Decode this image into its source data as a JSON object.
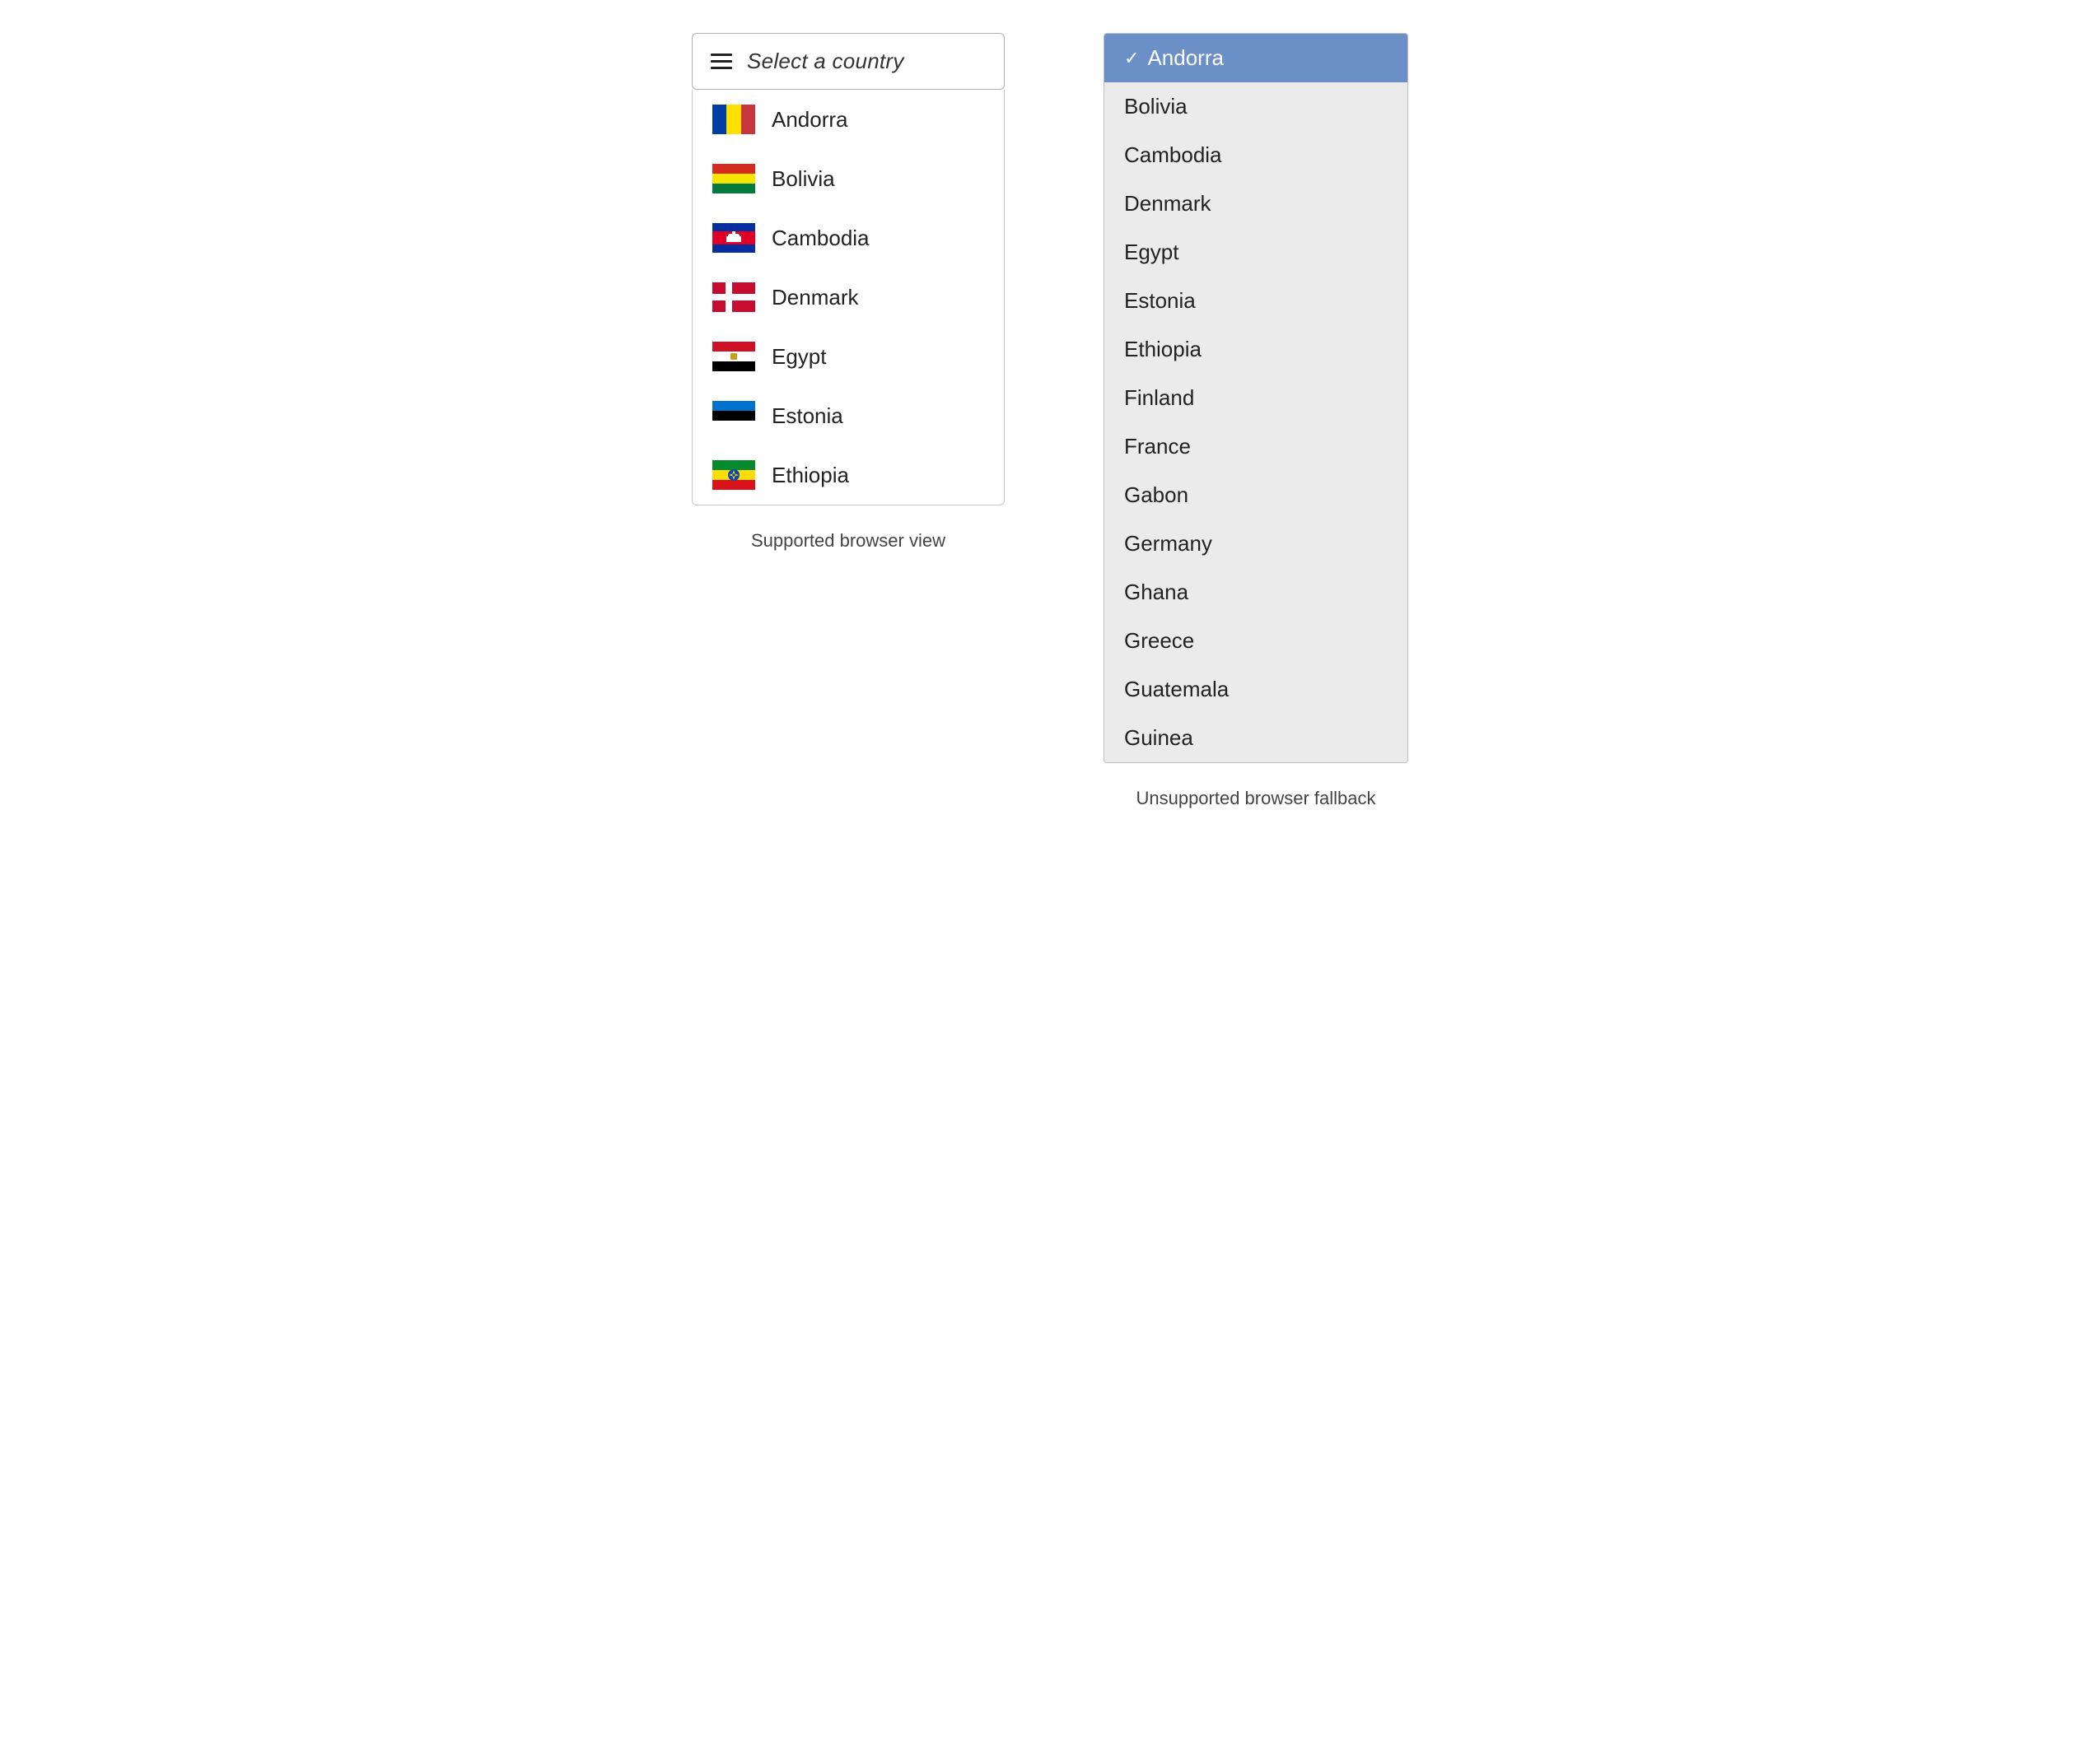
{
  "left": {
    "trigger_label": "Select a country",
    "caption": "Supported browser view",
    "countries": [
      {
        "id": "andorra",
        "name": "Andorra"
      },
      {
        "id": "bolivia",
        "name": "Bolivia"
      },
      {
        "id": "cambodia",
        "name": "Cambodia"
      },
      {
        "id": "denmark",
        "name": "Denmark"
      },
      {
        "id": "egypt",
        "name": "Egypt"
      },
      {
        "id": "estonia",
        "name": "Estonia"
      },
      {
        "id": "ethiopia",
        "name": "Ethiopia"
      }
    ]
  },
  "right": {
    "caption": "Unsupported browser fallback",
    "selected": "Andorra",
    "options": [
      "Andorra",
      "Bolivia",
      "Cambodia",
      "Denmark",
      "Egypt",
      "Estonia",
      "Ethiopia",
      "Finland",
      "France",
      "Gabon",
      "Germany",
      "Ghana",
      "Greece",
      "Guatemala",
      "Guinea"
    ]
  },
  "icons": {
    "hamburger": "hamburger-menu"
  }
}
